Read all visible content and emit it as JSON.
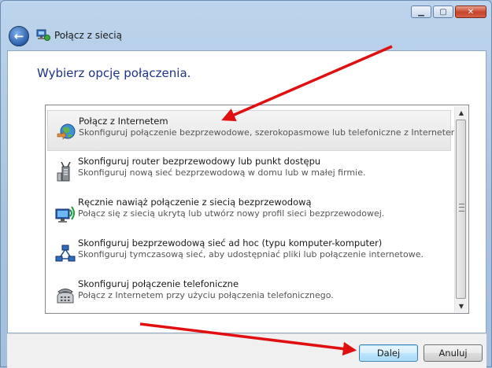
{
  "window": {
    "title": "Połącz z siecią",
    "minimize_glyph": "▁",
    "maximize_glyph": "▢",
    "close_glyph": "✕",
    "back_glyph": "←"
  },
  "content": {
    "heading": "Wybierz opcję połączenia."
  },
  "options": [
    {
      "title": "Połącz z Internetem",
      "desc": "Skonfiguruj połączenie bezprzewodowe, szerokopasmowe lub telefoniczne z Internetem.",
      "icon": "globe-icon",
      "selected": true
    },
    {
      "title": "Skonfiguruj router bezprzewodowy lub punkt dostępu",
      "desc": "Skonfiguruj nową sieć bezprzewodową w domu lub w małej firmie.",
      "icon": "router-icon",
      "selected": false
    },
    {
      "title": "Ręcznie nawiąż połączenie z siecią bezprzewodową",
      "desc": "Połącz się z siecią ukrytą lub utwórz nowy profil sieci bezprzewodowej.",
      "icon": "wireless-monitor-icon",
      "selected": false
    },
    {
      "title": "Skonfiguruj bezprzewodową sieć ad hoc (typu komputer-komputer)",
      "desc": "Skonfiguruj tymczasową sieć, aby udostępniać pliki lub połączenie internetowe.",
      "icon": "adhoc-network-icon",
      "selected": false
    },
    {
      "title": "Skonfiguruj połączenie telefoniczne",
      "desc": "Połącz z Internetem przy użyciu połączenia telefonicznego.",
      "icon": "telephone-icon",
      "selected": false
    }
  ],
  "scrollbar": {
    "up_glyph": "▲",
    "down_glyph": "▼"
  },
  "footer": {
    "next_label": "Dalej",
    "cancel_label": "Anuluj"
  },
  "colors": {
    "heading": "#1e3287",
    "annotation_arrow": "#e01010"
  }
}
